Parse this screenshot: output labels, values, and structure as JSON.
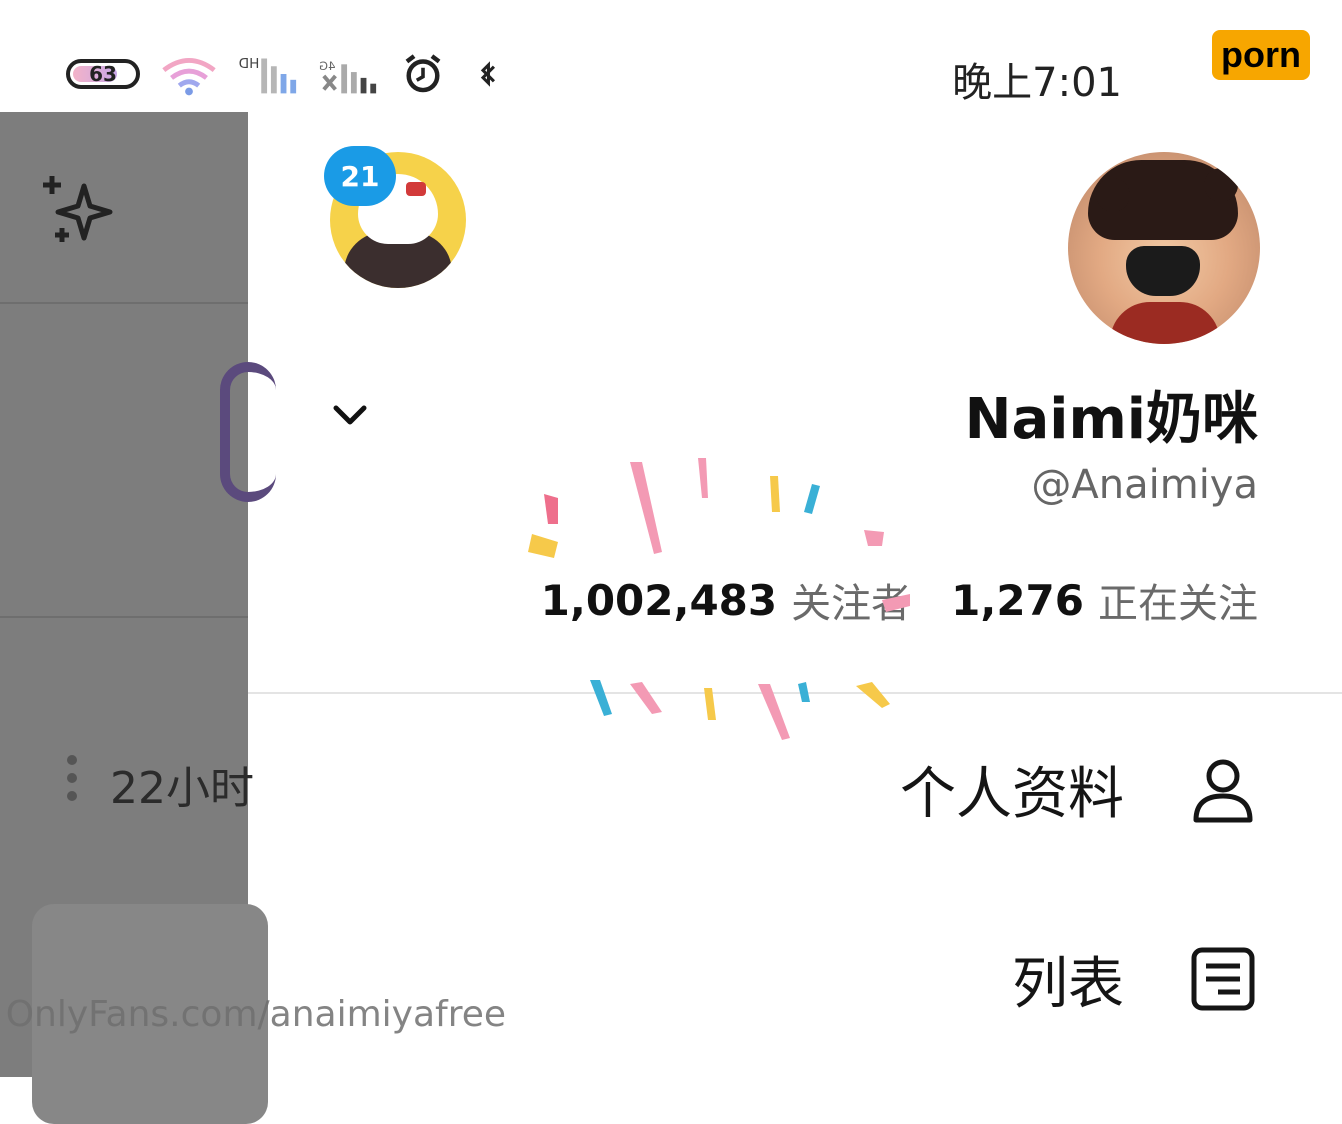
{
  "status_bar": {
    "time": "晚上7:01",
    "battery": "63",
    "icons": [
      "battery-icon",
      "wifi-icon",
      "signal-hd-icon",
      "signal-x-icon",
      "alarm-icon",
      "bluetooth-icon"
    ]
  },
  "drawer": {
    "profile": {
      "display_name": "Naimi奶咪",
      "handle": "@Anaimiya",
      "following_count": "1,276",
      "following_label": "正在关注",
      "followers_count": "1,002,483",
      "followers_label": "关注者"
    },
    "account_switcher": {
      "badge": "21"
    },
    "menu": [
      {
        "label": "个人资料",
        "icon": "person-icon"
      },
      {
        "label": "列表",
        "icon": "list-icon"
      }
    ]
  },
  "background_panel": {
    "time_ago": "22小时"
  },
  "watermark": "OnlyFans.com/anaimiyafree",
  "brand_label": "porn",
  "colors": {
    "badge": "#1a9be6",
    "brand": "#f7a600",
    "overlay": "#7d7d7d"
  }
}
